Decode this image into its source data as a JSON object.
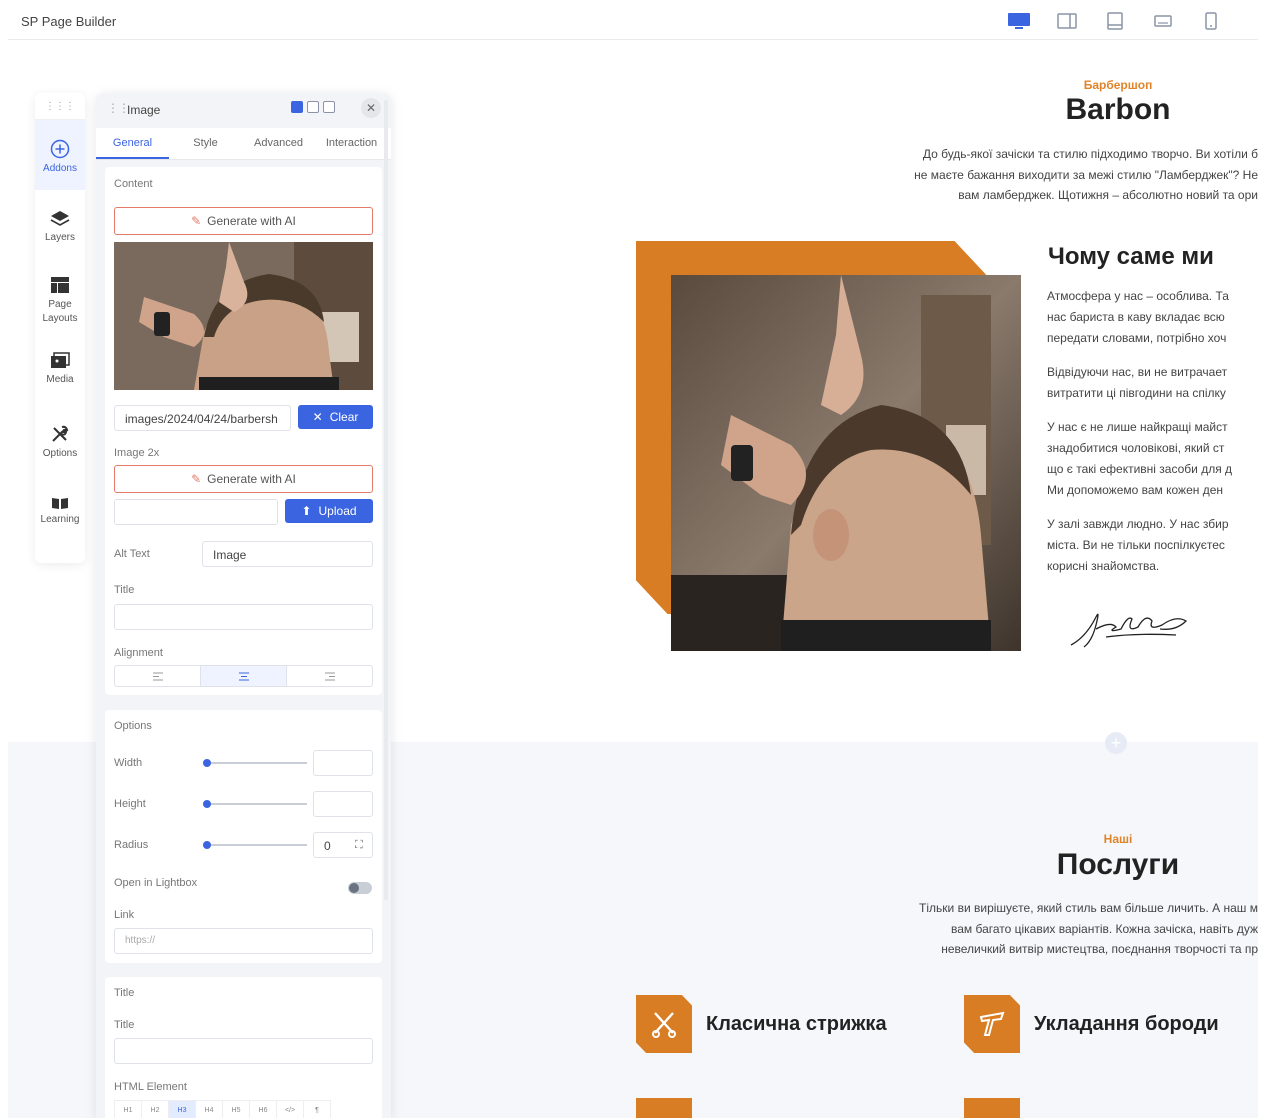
{
  "app": {
    "title": "SP Page Builder"
  },
  "devices": [
    "desktop-icon",
    "tablet-landscape-icon",
    "tablet-icon",
    "laptop-icon",
    "mobile-icon"
  ],
  "sidebar": {
    "items": [
      {
        "label": "Addons",
        "icon": "plus-circle-icon"
      },
      {
        "label": "Layers",
        "icon": "layers-icon"
      },
      {
        "label": "Page Layouts",
        "icon": "page-layouts-icon"
      },
      {
        "label": "Media",
        "icon": "media-icon"
      },
      {
        "label": "Options",
        "icon": "tools-icon"
      },
      {
        "label": "Learning",
        "icon": "book-icon"
      }
    ]
  },
  "panel": {
    "title": "Image",
    "tabs": [
      "General",
      "Style",
      "Advanced",
      "Interaction"
    ],
    "content": {
      "section_label": "Content",
      "generate_ai": "Generate with AI",
      "image_path": "images/2024/04/24/barbersh",
      "clear": "Clear",
      "image2x_label": "Image 2x",
      "generate_ai_2": "Generate with AI",
      "upload": "Upload",
      "alt_label": "Alt Text",
      "alt_value": "Image",
      "title_label": "Title",
      "alignment_label": "Alignment"
    },
    "options": {
      "section_label": "Options",
      "width_label": "Width",
      "height_label": "Height",
      "radius_label": "Radius",
      "radius_value": "0",
      "lightbox_label": "Open in Lightbox",
      "link_label": "Link",
      "link_placeholder": "https://"
    },
    "title_section": {
      "section_label": "Title",
      "title_label": "Title",
      "html_label": "HTML Element",
      "html_options": [
        "H1",
        "H2",
        "H3",
        "H4",
        "H5",
        "H6",
        "</>",
        "¶"
      ]
    }
  },
  "page": {
    "kicker1": "Барбершоп",
    "heading1": "Barbon",
    "intro_lines": [
      "До будь-якої зачіски та стилю підходимо творчо. Ви хотіли б",
      "не маєте бажання виходити за межі стилю \"Ламберджек\"? Не",
      "вам ламберджек. Щотижня – абсолютно новий та ори"
    ],
    "why_title": "Чому саме ми",
    "paragraphs": [
      [
        "Атмосфера у нас – особлива. Та",
        "нас бариста в каву вкладає всю",
        "передати словами, потрібно хоч"
      ],
      [
        "Відвідуючи нас, ви не витрачает",
        "витратити ці півгодини на спілку"
      ],
      [
        "У нас є не лише найкращі майст",
        "знадобитися чоловікові, який ст",
        "що є такі ефективні засоби для д",
        "Ми допоможемо вам кожен ден"
      ],
      [
        "У залі завжди людно. У нас збир",
        "міста. Ви не тільки поспілкуєтес",
        "корисні знайомства."
      ]
    ],
    "kicker2": "Наші",
    "heading2": "Послуги",
    "services_intro": [
      "Тільки ви вирішуєте, який стиль вам більше личить. А наш м",
      "вам багато цікавих варіантів. Кожна зачіска, навіть дуж",
      "невеличкий витвір мистецтва, поєднання творчості та пр"
    ],
    "services": [
      {
        "label": "Класична стрижка",
        "icon": "scissors-comb-icon"
      },
      {
        "label": "Укладання бороди",
        "icon": "razor-icon"
      }
    ]
  },
  "colors": {
    "accent": "#d87d24",
    "primary": "#3b64e0"
  }
}
